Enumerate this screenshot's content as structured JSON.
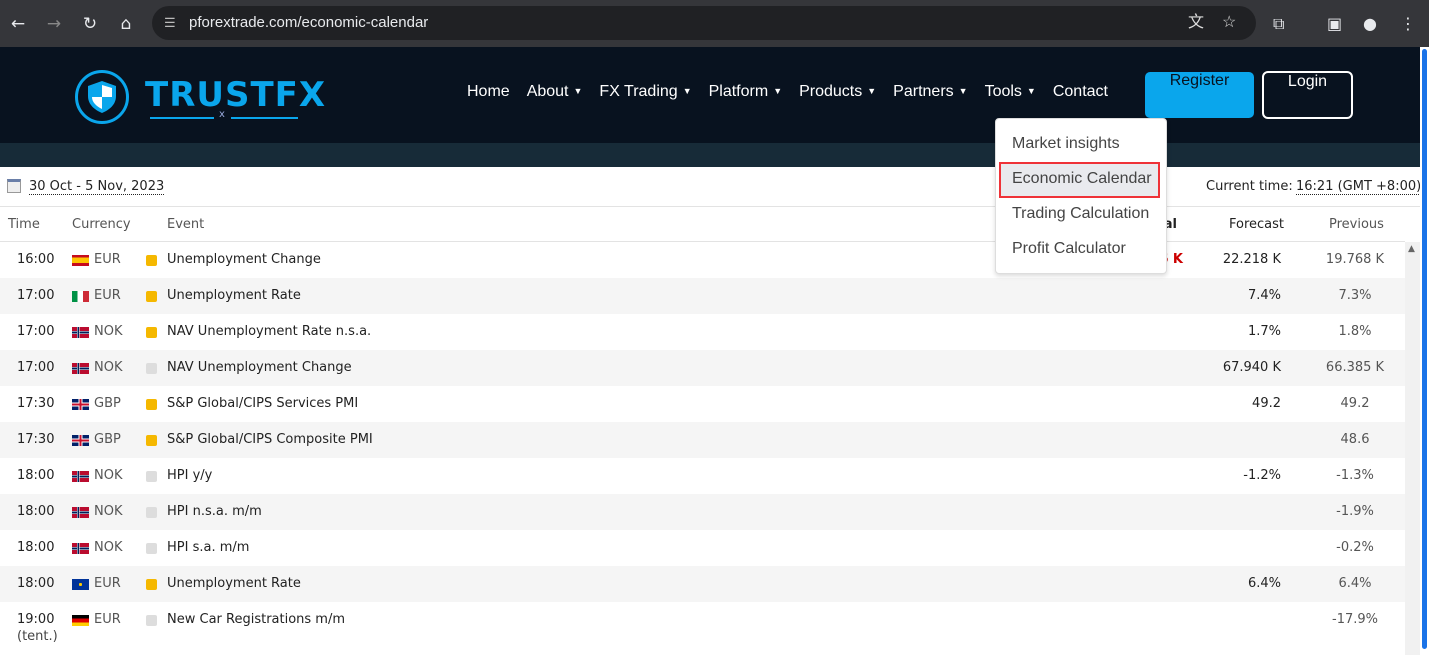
{
  "browser": {
    "url": "pforextrade.com/economic-calendar"
  },
  "brand": {
    "name": "TRUSTFX",
    "sub": "x",
    "accent": "#0aa6ec"
  },
  "nav": [
    {
      "label": "Home",
      "caret": false
    },
    {
      "label": "About",
      "caret": true
    },
    {
      "label": "FX Trading",
      "caret": true
    },
    {
      "label": "Platform",
      "caret": true
    },
    {
      "label": "Products",
      "caret": true
    },
    {
      "label": "Partners",
      "caret": true
    },
    {
      "label": "Tools",
      "caret": true
    },
    {
      "label": "Contact",
      "caret": false
    }
  ],
  "buttons": {
    "register": "Register",
    "login": "Login"
  },
  "tools_menu": [
    "Market insights",
    "Economic Calendar",
    "Trading Calculation",
    "Profit Calculator"
  ],
  "toolbar": {
    "date_range": "30 Oct - 5 Nov, 2023",
    "current_time_label": "Current time:",
    "current_time": "16:21 (GMT +8:00)"
  },
  "columns": {
    "time": "Time",
    "currency": "Currency",
    "event": "Event",
    "actual": "al",
    "forecast": "Forecast",
    "previous": "Previous"
  },
  "rows": [
    {
      "time": "16:00",
      "flag": "es",
      "currency": "EUR",
      "importance": "medium",
      "event": "Unemployment Change",
      "actual": "6 K",
      "forecast": "22.218 K",
      "previous": "19.768 K"
    },
    {
      "time": "17:00",
      "flag": "it",
      "currency": "EUR",
      "importance": "medium",
      "event": "Unemployment Rate",
      "actual": "",
      "forecast": "7.4%",
      "previous": "7.3%"
    },
    {
      "time": "17:00",
      "flag": "no",
      "currency": "NOK",
      "importance": "medium",
      "event": "NAV Unemployment Rate n.s.a.",
      "actual": "",
      "forecast": "1.7%",
      "previous": "1.8%"
    },
    {
      "time": "17:00",
      "flag": "no",
      "currency": "NOK",
      "importance": "low",
      "event": "NAV Unemployment Change",
      "actual": "",
      "forecast": "67.940 K",
      "previous": "66.385 K"
    },
    {
      "time": "17:30",
      "flag": "gb",
      "currency": "GBP",
      "importance": "medium",
      "event": "S&P Global/CIPS Services PMI",
      "actual": "",
      "forecast": "49.2",
      "previous": "49.2"
    },
    {
      "time": "17:30",
      "flag": "gb",
      "currency": "GBP",
      "importance": "medium",
      "event": "S&P Global/CIPS Composite PMI",
      "actual": "",
      "forecast": "",
      "previous": "48.6"
    },
    {
      "time": "18:00",
      "flag": "no",
      "currency": "NOK",
      "importance": "low",
      "event": "HPI y/y",
      "actual": "",
      "forecast": "-1.2%",
      "previous": "-1.3%"
    },
    {
      "time": "18:00",
      "flag": "no",
      "currency": "NOK",
      "importance": "low",
      "event": "HPI n.s.a. m/m",
      "actual": "",
      "forecast": "",
      "previous": "-1.9%"
    },
    {
      "time": "18:00",
      "flag": "no",
      "currency": "NOK",
      "importance": "low",
      "event": "HPI s.a. m/m",
      "actual": "",
      "forecast": "",
      "previous": "-0.2%"
    },
    {
      "time": "18:00",
      "flag": "eu",
      "currency": "EUR",
      "importance": "medium",
      "event": "Unemployment Rate",
      "actual": "",
      "forecast": "6.4%",
      "previous": "6.4%"
    },
    {
      "time": "19:00",
      "time_note": "(tent.)",
      "flag": "de",
      "currency": "EUR",
      "importance": "low",
      "event": "New Car Registrations m/m",
      "actual": "",
      "forecast": "",
      "previous": "-17.9%"
    }
  ],
  "colors": {
    "importance_medium": "#f5b800",
    "importance_low": "#dddddd",
    "actual_negative": "#cc0000"
  }
}
